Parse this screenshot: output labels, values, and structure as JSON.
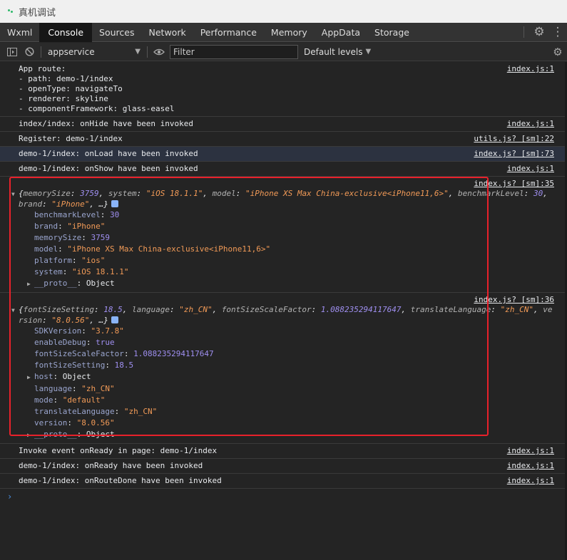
{
  "window": {
    "title": "真机调试"
  },
  "tabs": [
    "Wxml",
    "Console",
    "Sources",
    "Network",
    "Performance",
    "Memory",
    "AppData",
    "Storage"
  ],
  "active_tab": "Console",
  "toolbar": {
    "context": "appservice",
    "filter_placeholder": "Filter",
    "levels": "Default levels"
  },
  "messages": [
    {
      "lines": [
        "App route:",
        "- path: demo-1/index",
        "- openType: navigateTo",
        "- renderer: skyline",
        "- componentFramework: glass-easel"
      ],
      "source": "index.js:1"
    },
    {
      "lines": [
        "index/index: onHide have been invoked"
      ],
      "source": "index.js:1"
    },
    {
      "lines": [
        "Register: demo-1/index"
      ],
      "source": "utils.js? [sm]:22"
    },
    {
      "lines": [
        "demo-1/index: onLoad have been invoked"
      ],
      "source": "index.js? [sm]:73"
    },
    {
      "lines": [
        "demo-1/index: onShow have been invoked"
      ],
      "source": "index.js:1"
    }
  ],
  "device_object": {
    "source": "index.js? [sm]:35",
    "summary_1_parts": [
      "{",
      "memorySize",
      ": ",
      "3759",
      ", ",
      "system",
      ": ",
      "\"iOS 18.1.1\"",
      ", ",
      "model",
      ": ",
      "\"iPhone XS Max China-exclusive<iPhone11,6>\"",
      ", ",
      "benchmarkLevel",
      ": ",
      "30",
      ","
    ],
    "summary_2_parts": [
      "brand",
      ": ",
      "\"iPhone\"",
      ", …}"
    ],
    "props": [
      {
        "key": "benchmarkLevel",
        "value": "30",
        "type": "number"
      },
      {
        "key": "brand",
        "value": "\"iPhone\"",
        "type": "string"
      },
      {
        "key": "memorySize",
        "value": "3759",
        "type": "number"
      },
      {
        "key": "model",
        "value": "\"iPhone XS Max China-exclusive<iPhone11,6>\"",
        "type": "string"
      },
      {
        "key": "platform",
        "value": "\"ios\"",
        "type": "string"
      },
      {
        "key": "system",
        "value": "\"iOS 18.1.1\"",
        "type": "string"
      },
      {
        "key": "__proto__",
        "value": "Object",
        "type": "proto",
        "expandable": true
      }
    ]
  },
  "app_object": {
    "source": "index.js? [sm]:36",
    "summary_1_parts": [
      "{",
      "fontSizeSetting",
      ": ",
      "18.5",
      ", ",
      "language",
      ": ",
      "\"zh_CN\"",
      ", ",
      "fontSizeScaleFactor",
      ": ",
      "1.088235294117647",
      ", ",
      "translateLanguage",
      ": ",
      "\"zh_CN\"",
      ", ",
      "ve"
    ],
    "summary_2_parts": [
      "rsion",
      ": ",
      "\"8.0.56\"",
      ", …}"
    ],
    "props": [
      {
        "key": "SDKVersion",
        "value": "\"3.7.8\"",
        "type": "string"
      },
      {
        "key": "enableDebug",
        "value": "true",
        "type": "bool"
      },
      {
        "key": "fontSizeScaleFactor",
        "value": "1.088235294117647",
        "type": "number"
      },
      {
        "key": "fontSizeSetting",
        "value": "18.5",
        "type": "number"
      },
      {
        "key": "host",
        "value": "Object",
        "type": "proto",
        "expandable": true
      },
      {
        "key": "language",
        "value": "\"zh_CN\"",
        "type": "string"
      },
      {
        "key": "mode",
        "value": "\"default\"",
        "type": "string"
      },
      {
        "key": "translateLanguage",
        "value": "\"zh_CN\"",
        "type": "string"
      },
      {
        "key": "version",
        "value": "\"8.0.56\"",
        "type": "string"
      },
      {
        "key": "__proto__",
        "value": "Object",
        "type": "proto",
        "expandable": true
      }
    ]
  },
  "messages_after": [
    {
      "lines": [
        "Invoke event onReady in page: demo-1/index"
      ],
      "source": "index.js:1"
    },
    {
      "lines": [
        "demo-1/index: onReady have been invoked"
      ],
      "source": "index.js:1"
    },
    {
      "lines": [
        "demo-1/index: onRouteDone have been invoked"
      ],
      "source": "index.js:1"
    }
  ],
  "prompt_symbol": "›",
  "colors": {
    "highlight_box": "#e8212b",
    "string": "#f19a57",
    "number": "#9f8ff0",
    "key": "#9aa5ce"
  },
  "icons": [
    "sidebar-toggle-icon",
    "clear-console-icon",
    "eye-icon",
    "gear-icon",
    "more-vert-icon"
  ]
}
